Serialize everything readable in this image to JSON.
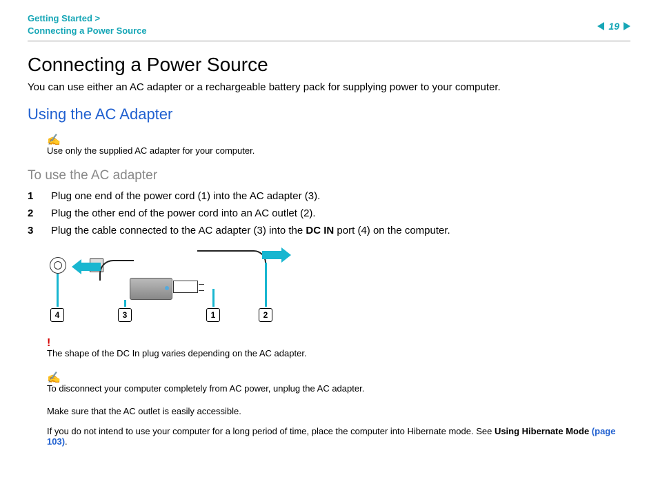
{
  "header": {
    "breadcrumb_line1": "Getting Started >",
    "breadcrumb_line2": "Connecting a Power Source",
    "page_number": "19"
  },
  "title": "Connecting a Power Source",
  "intro": "You can use either an AC adapter or a rechargeable battery pack for supplying power to your computer.",
  "section_heading": "Using the AC Adapter",
  "note1_text": "Use only the supplied AC adapter for your computer.",
  "subsection_heading": "To use the AC adapter",
  "steps": [
    "Plug one end of the power cord (1) into the AC adapter (3).",
    "Plug the other end of the power cord into an AC outlet (2).",
    "Plug the cable connected to the AC adapter (3) into the DC IN port (4) on the computer."
  ],
  "step3_bold": "DC IN",
  "diagram_labels": {
    "l1": "1",
    "l2": "2",
    "l3": "3",
    "l4": "4"
  },
  "warning_text": "The shape of the DC In plug varies depending on the AC adapter.",
  "note2_text": "To disconnect your computer completely from AC power, unplug the AC adapter.",
  "body1": "Make sure that the AC outlet is easily accessible.",
  "body2_pre": "If you do not intend to use your computer for a long period of time, place the computer into Hibernate mode. See ",
  "body2_bold": "Using Hibernate Mode ",
  "body2_link": "(page 103)",
  "body2_post": "."
}
